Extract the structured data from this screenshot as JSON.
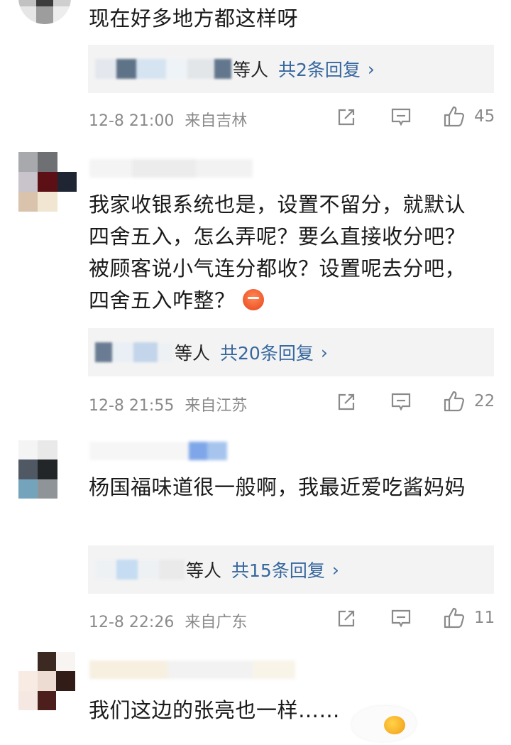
{
  "comments": [
    {
      "text": "现在好多地方都这样呀",
      "reply_suffix": "等人",
      "reply_count": "共2条回复",
      "time": "12-8 21:00",
      "location": "来自吉林",
      "likes": "45"
    },
    {
      "text": "我家收银系统也是，设置不留分，就默认四舍五入，怎么弄呢？要么直接收分吧？被顾客说小气连分都收？设置呢去分吧，四舍五入咋整？",
      "reply_suffix": "等人",
      "reply_count": "共20条回复",
      "time": "12-8 21:55",
      "location": "来自江苏",
      "likes": "22"
    },
    {
      "text": "杨国福味道很一般啊，我最近爱吃酱妈妈",
      "reply_suffix": "等人",
      "reply_count": "共15条回复",
      "time": "12-8 22:26",
      "location": "来自广东",
      "likes": "11"
    },
    {
      "text": "我们这边的张亮也一样……"
    }
  ],
  "icons": {
    "share": "share-icon",
    "comment": "comment-icon",
    "like": "like-icon"
  },
  "colors": {
    "link": "#36679e",
    "meta": "#8a8a8a",
    "reply_bg": "#f3f3f3"
  }
}
